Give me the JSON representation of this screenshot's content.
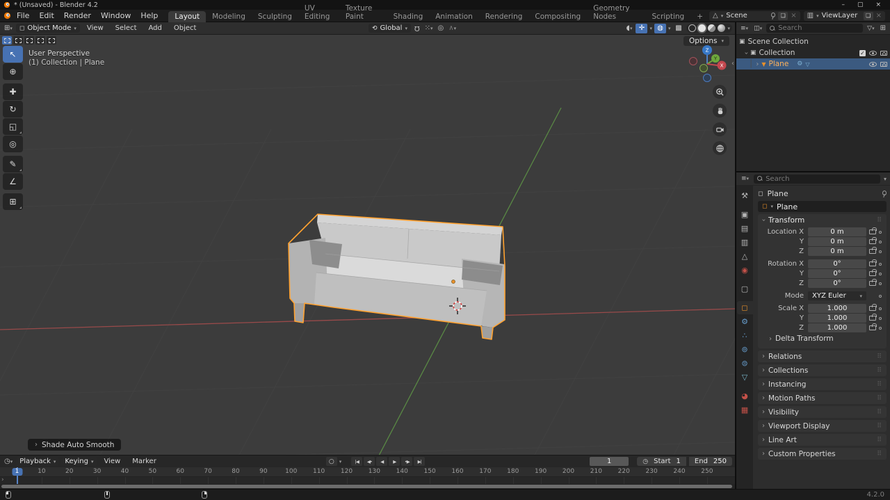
{
  "window": {
    "title": "* (Unsaved) - Blender 4.2",
    "minimize": "–",
    "maximize": "▢",
    "close": "×"
  },
  "topbar": {
    "menus": [
      "File",
      "Edit",
      "Render",
      "Window",
      "Help"
    ],
    "workspaces": [
      {
        "label": "Layout",
        "active": true
      },
      {
        "label": "Modeling",
        "active": false
      },
      {
        "label": "Sculpting",
        "active": false
      },
      {
        "label": "UV Editing",
        "active": false
      },
      {
        "label": "Texture Paint",
        "active": false
      },
      {
        "label": "Shading",
        "active": false
      },
      {
        "label": "Animation",
        "active": false
      },
      {
        "label": "Rendering",
        "active": false
      },
      {
        "label": "Compositing",
        "active": false
      },
      {
        "label": "Geometry Nodes",
        "active": false
      },
      {
        "label": "Scripting",
        "active": false
      },
      {
        "label": "+",
        "active": false
      }
    ],
    "scene_label": "Scene",
    "view_layer_label": "ViewLayer"
  },
  "viewport_header": {
    "mode": "Object Mode",
    "menus": [
      "View",
      "Select",
      "Add",
      "Object"
    ],
    "orientation": "Global",
    "options_label": "Options"
  },
  "toolbar": {
    "tools": [
      {
        "name": "select-box",
        "glyph": "↖",
        "active": true,
        "sub": false
      },
      {
        "name": "cursor",
        "glyph": "⊕",
        "active": false,
        "sub": false
      },
      {
        "name": "move",
        "glyph": "✚",
        "active": false,
        "sub": false
      },
      {
        "name": "rotate",
        "glyph": "↻",
        "active": false,
        "sub": false
      },
      {
        "name": "scale",
        "glyph": "◱",
        "active": false,
        "sub": true
      },
      {
        "name": "transform",
        "glyph": "◎",
        "active": false,
        "sub": false
      },
      {
        "name": "annotate",
        "glyph": "✎",
        "active": false,
        "sub": true
      },
      {
        "name": "measure",
        "glyph": "∠",
        "active": false,
        "sub": false
      },
      {
        "name": "add-cube",
        "glyph": "⊞",
        "active": false,
        "sub": true
      }
    ]
  },
  "viewport": {
    "view_label": "User Perspective",
    "context_label": "(1) Collection | Plane",
    "operator_label": "Shade Auto Smooth",
    "axis_x": "X",
    "axis_y": "Y",
    "axis_z": "Z"
  },
  "outliner": {
    "search_placeholder": "Search",
    "rows": [
      {
        "label": "Scene Collection"
      },
      {
        "label": "Collection"
      },
      {
        "label": "Plane",
        "selected": true
      }
    ]
  },
  "properties": {
    "search_placeholder": "Search",
    "breadcrumb": "Plane",
    "name_value": "Plane",
    "tabs": [
      {
        "name": "tool",
        "glyph": "⚒",
        "color": "#b5b5b5",
        "active": false,
        "gap": false
      },
      {
        "name": "render",
        "glyph": "▣",
        "color": "#b5b5b5",
        "active": false,
        "gap": true
      },
      {
        "name": "output",
        "glyph": "▤",
        "color": "#b5b5b5",
        "active": false,
        "gap": false
      },
      {
        "name": "view-layer",
        "glyph": "▥",
        "color": "#b5b5b5",
        "active": false,
        "gap": false
      },
      {
        "name": "scene",
        "glyph": "△",
        "color": "#b5b5b5",
        "active": false,
        "gap": false
      },
      {
        "name": "world",
        "glyph": "◉",
        "color": "#c25048",
        "active": false,
        "gap": false
      },
      {
        "name": "collection",
        "glyph": "▢",
        "color": "#b5b5b5",
        "active": false,
        "gap": true
      },
      {
        "name": "object",
        "glyph": "◻",
        "color": "#e8902a",
        "active": true,
        "gap": true
      },
      {
        "name": "modifiers",
        "glyph": "⚙",
        "color": "#689fd0",
        "active": false,
        "gap": false
      },
      {
        "name": "particles",
        "glyph": "∴",
        "color": "#689fd0",
        "active": false,
        "gap": false
      },
      {
        "name": "physics",
        "glyph": "⊚",
        "color": "#689fd0",
        "active": false,
        "gap": false
      },
      {
        "name": "constraints",
        "glyph": "⊜",
        "color": "#689fd0",
        "active": false,
        "gap": false
      },
      {
        "name": "data",
        "glyph": "▽",
        "color": "#77b5c9",
        "active": false,
        "gap": false
      },
      {
        "name": "material",
        "glyph": "◕",
        "color": "#c25048",
        "active": false,
        "gap": true
      },
      {
        "name": "texture",
        "glyph": "▦",
        "color": "#c25048",
        "active": false,
        "gap": false
      }
    ],
    "transform": {
      "title": "Transform",
      "location": [
        {
          "label": "Location X",
          "value": "0 m"
        },
        {
          "label": "Y",
          "value": "0 m"
        },
        {
          "label": "Z",
          "value": "0 m"
        }
      ],
      "rotation": [
        {
          "label": "Rotation X",
          "value": "0°"
        },
        {
          "label": "Y",
          "value": "0°"
        },
        {
          "label": "Z",
          "value": "0°"
        }
      ],
      "mode_label": "Mode",
      "mode_value": "XYZ Euler",
      "scale": [
        {
          "label": "Scale X",
          "value": "1.000"
        },
        {
          "label": "Y",
          "value": "1.000"
        },
        {
          "label": "Z",
          "value": "1.000"
        }
      ],
      "delta_label": "Delta Transform"
    },
    "collapsed_panels": [
      "Relations",
      "Collections",
      "Instancing",
      "Motion Paths",
      "Visibility",
      "Viewport Display",
      "Line Art",
      "Custom Properties"
    ]
  },
  "timeline": {
    "menus": [
      "Playback",
      "Keying",
      "View",
      "Marker"
    ],
    "transport": [
      "|◀",
      "◀•",
      "◀",
      "▶",
      "•▶",
      "▶|"
    ],
    "current_frame": "1",
    "start_label": "Start",
    "start_value": "1",
    "end_label": "End",
    "end_value": "250",
    "playhead_label": "1",
    "ticks": [
      "10",
      "20",
      "30",
      "40",
      "50",
      "60",
      "70",
      "80",
      "90",
      "100",
      "110",
      "120",
      "130",
      "140",
      "150",
      "160",
      "170",
      "180",
      "190",
      "200",
      "210",
      "220",
      "230",
      "240",
      "250"
    ]
  },
  "status_bar": {
    "version": "4.2.0"
  },
  "colors": {
    "accent_blue": "#4772b3",
    "accent_orange": "#e8902a",
    "selection_outline": "#ffa230",
    "axis_x_red": "#a84c4c",
    "axis_y_green": "#5f9646"
  }
}
